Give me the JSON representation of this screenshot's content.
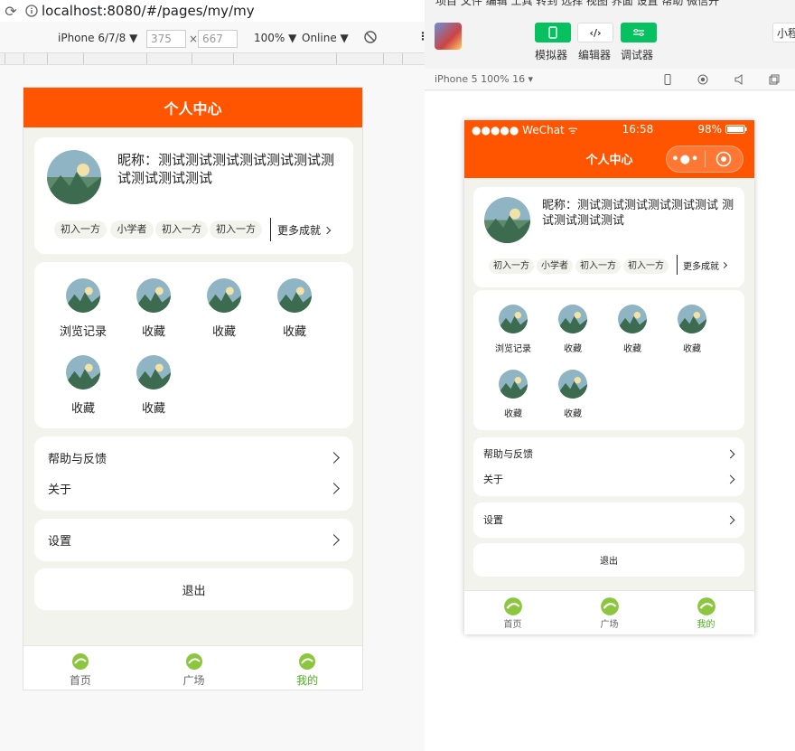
{
  "browser": {
    "url": "localhost:8080/#/pages/my/my",
    "device": "iPhone 6/7/8 ▼",
    "width": "375",
    "times": "×",
    "height": "667",
    "zoom": "100% ▼",
    "network": "Online ▼"
  },
  "wechat_tool": {
    "menu": "项目  文件  编辑  工具  转到  选择  视图  界面  设置  帮助  微信开",
    "buttons": [
      {
        "label": "模拟器",
        "icon": "phone-icon",
        "color": "#07c160"
      },
      {
        "label": "编辑器",
        "icon": "code-icon",
        "color": "#ffffff"
      },
      {
        "label": "调试器",
        "icon": "debug-icon",
        "color": "#07c160"
      }
    ],
    "small_btn": "小程",
    "device_label": "iPhone 5 100% 16 ▾",
    "status_left": "●●●●● WeChat ᯤ",
    "status_time": "16:58",
    "status_right": "98%",
    "capsule_dots": "•●•"
  },
  "page": {
    "nav_title": "个人中心",
    "nickname": "昵称：测试测试测试测试测试测试测试测试测试测试",
    "nickname_r": "昵称：测试测试测试测试测试测试 测试测试测试测试",
    "badges": [
      "初入一方",
      "小学者",
      "初入一方",
      "初入一方"
    ],
    "more": "更多成就",
    "grid": [
      "浏览记录",
      "收藏",
      "收藏",
      "收藏",
      "收藏",
      "收藏"
    ],
    "list1": [
      "帮助与反馈",
      "关于"
    ],
    "list2": [
      "设置"
    ],
    "logout": "退出",
    "tabs": [
      {
        "label": "首页",
        "active": false
      },
      {
        "label": "广场",
        "active": false
      },
      {
        "label": "我的",
        "active": true
      }
    ]
  }
}
